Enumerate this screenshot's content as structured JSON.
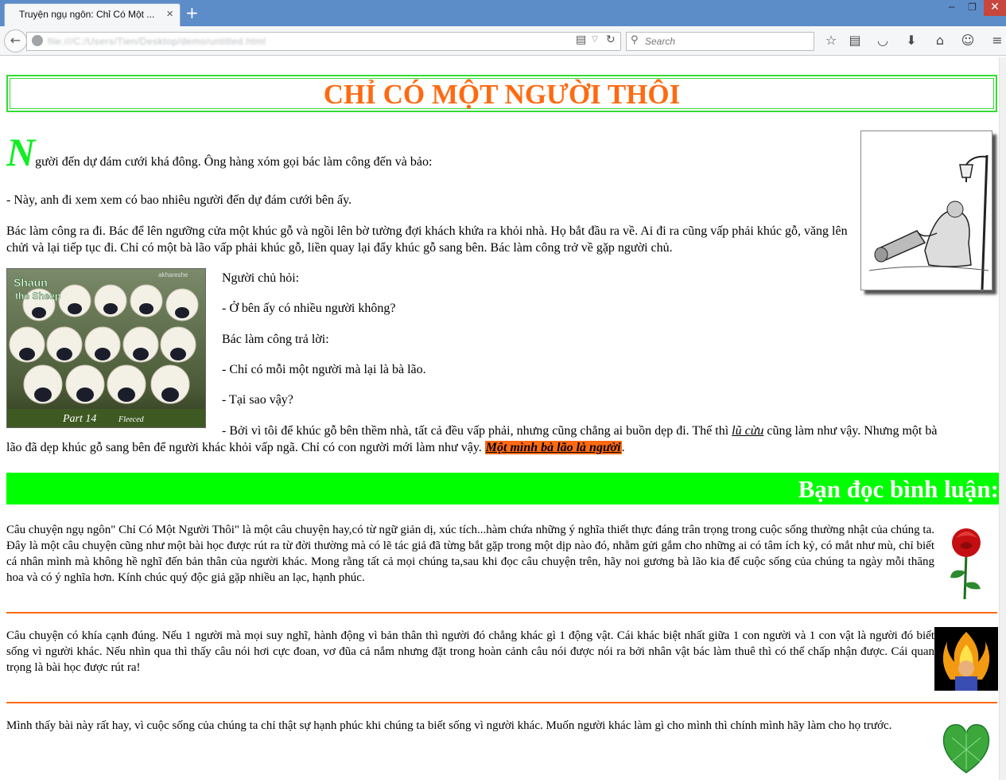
{
  "browser": {
    "tab_title": "Truyện ngụ ngôn: Chỉ Có Một ...",
    "tab_close": "×",
    "new_tab": "+",
    "window_controls": {
      "minimize": "─",
      "maximize": "❐",
      "close": "✕"
    },
    "back_glyph": "←",
    "url_blurred": "file:///C:/Users/Tien/Desktop/demo/untitled.html",
    "search_placeholder": "Search",
    "toolbar_icons": [
      "star-icon",
      "reading-list-icon",
      "pocket-icon",
      "download-icon",
      "home-icon",
      "chat-icon",
      "menu-icon"
    ]
  },
  "article": {
    "title": "CHỈ CÓ MỘT NGƯỜI THÔI",
    "dropcap": "N",
    "p1_rest": "gười đến dự đám cưới khá đông. Ông hàng xóm gọi bác làm công đến và bảo:",
    "p2": "- Này, anh đi xem xem có bao nhiêu người đến dự đám cưới bên ấy.",
    "p3": "Bác làm công ra đi. Bác để lên ngưỡng cửa một khúc gỗ và ngồi lên bờ tường đợi khách khứa ra khỏi nhà. Họ bắt đầu ra về. Ai đi ra cũng vấp phải khúc gỗ, văng lên chửi và lại tiếp tục đi. Chỉ có một bà lão vấp phải khúc gỗ, liền quay lại đẩy khúc gỗ sang bên. Bác làm công trở về gặp người chủ.",
    "d1": "Người chủ hỏi:",
    "d2": "- Ở bên ấy có nhiều người không?",
    "d3": "Bác làm công trả lời:",
    "d4": "- Chỉ có mỗi một người mà lại là bà lão.",
    "d5": "- Tại sao vậy?",
    "d6_a": "- Bởi vì tôi để khúc gỗ bên thềm nhà, tất cả đều vấp phải, nhưng cũng chẳng ai buồn dẹp đi. Thế thì ",
    "d6_link": "lũ cừu",
    "d6_b": " cũng làm như vậy. Nhưng một bà",
    "d6_c": "lão đã dẹp khúc gỗ sang bên để người khác khỏi vấp ngã. Chỉ có con người mới làm như vậy. ",
    "d6_highlight": "Một mình bà lão là người",
    "d6_end": ".",
    "sheep_image_text": {
      "shaun": "Shaun",
      "the_sheep": "the Sheep",
      "part": "Part 14",
      "fleeced": "Fleeced",
      "watermark": "akhareshe"
    }
  },
  "comments": {
    "heading": "Bạn đọc bình luận:",
    "items": [
      {
        "text": "Câu chuyện ngụ ngôn\" Chỉ Có Một Người Thôi\" là một câu chuyện hay,có từ ngữ giản dị, xúc tích...hàm chứa những ý nghĩa thiết thực đáng trân trọng trong cuộc sống thường nhật của chúng ta. Đây là một câu chuyện cũng như một bài học được rút ra từ đời thường mà có lẽ tác giả đã từng bắt gặp trong một dịp nào đó, nhằm gửi gắm cho những ai có tâm ích kỷ, có mắt như mù, chỉ biết cá nhân mình mà không hề nghĩ đến bản thân của người khác. Mong rằng tất cả mọi chúng ta,sau khi đọc câu chuyện trên, hãy noi gương bà lão kia để cuộc sống của chúng ta ngày mỗi thăng hoa và có ý nghĩa hơn. Kính chúc quý độc giả gặp nhiều an lạc, hạnh phúc.",
        "avatar": "rose-icon"
      },
      {
        "text": "Câu chuyện có khía cạnh đúng. Nếu 1 người mà mọi suy nghĩ, hành động vì bản thân thì người đó chẳng khác gì 1 động vật. Cái khác biệt nhất giữa 1 con người và 1 con vật là người đó biết sống vì người khác. Nếu nhìn qua thì thấy câu nói hơi cực đoan, vơ đũa cả nắm nhưng đặt trong hoàn cảnh câu nói được nói ra bởi nhân vật bác làm thuê thì có thể chấp nhận được. Cái quan trọng là bài học được rút ra!",
        "avatar": "fire-avatar-icon"
      },
      {
        "text": "Mình thấy bài này rất hay, vì cuộc sống của chúng ta chỉ thật sự hạnh phúc khi chúng ta biết sống vì người khác. Muốn người khác làm gì cho mình thì chính mình hãy làm cho họ trước.",
        "avatar": "green-heart-icon"
      }
    ]
  },
  "colors": {
    "title": "#ff6a11",
    "accent_green": "#00ff00",
    "dropcap": "#11ee22",
    "separator": "#ff6a11"
  }
}
